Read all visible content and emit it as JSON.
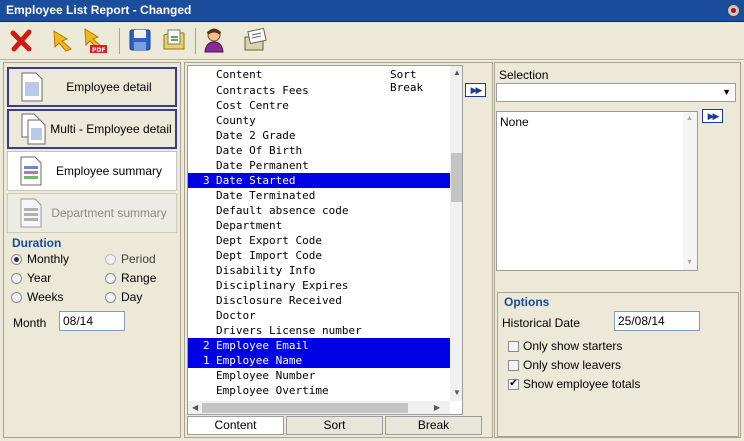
{
  "window": {
    "title": "Employee List Report - Changed"
  },
  "toolbar": {
    "items": [
      "delete-icon",
      "run-report-icon",
      "export-pdf-icon",
      "save-icon",
      "open-icon",
      "user-icon",
      "options-icon"
    ]
  },
  "reports": [
    {
      "label": "Employee detail"
    },
    {
      "label": "Multi - Employee detail"
    },
    {
      "label": "Employee summary"
    },
    {
      "label": "Department summary"
    }
  ],
  "duration": {
    "title": "Duration",
    "options": [
      "Monthly",
      "Period",
      "Year",
      "Range",
      "Weeks",
      "Day"
    ],
    "selected": "Monthly",
    "month_label": "Month",
    "month_value": "08/14"
  },
  "content_list": {
    "header_content": "Content",
    "header_sort": "Sort Break",
    "rows": [
      {
        "num": "",
        "text": "Contracts Fees",
        "selected": false
      },
      {
        "num": "",
        "text": "Cost Centre",
        "selected": false
      },
      {
        "num": "",
        "text": "County",
        "selected": false
      },
      {
        "num": "",
        "text": "Date 2 Grade",
        "selected": false
      },
      {
        "num": "",
        "text": "Date Of Birth",
        "selected": false
      },
      {
        "num": "",
        "text": "Date Permanent",
        "selected": false
      },
      {
        "num": "3",
        "text": "Date Started",
        "selected": true
      },
      {
        "num": "",
        "text": "Date Terminated",
        "selected": false
      },
      {
        "num": "",
        "text": "Default absence code",
        "selected": false
      },
      {
        "num": "",
        "text": "Department",
        "selected": false
      },
      {
        "num": "",
        "text": "Dept Export Code",
        "selected": false
      },
      {
        "num": "",
        "text": "Dept Import Code",
        "selected": false
      },
      {
        "num": "",
        "text": "Disability Info",
        "selected": false
      },
      {
        "num": "",
        "text": "Disciplinary Expires",
        "selected": false
      },
      {
        "num": "",
        "text": "Disclosure Received",
        "selected": false
      },
      {
        "num": "",
        "text": "Doctor",
        "selected": false
      },
      {
        "num": "",
        "text": "Drivers License number",
        "selected": false
      },
      {
        "num": "2",
        "text": "Employee Email",
        "selected": true
      },
      {
        "num": "1",
        "text": "Employee Name",
        "selected": true
      },
      {
        "num": "",
        "text": "Employee Number",
        "selected": false
      },
      {
        "num": "",
        "text": "Employee Overtime",
        "selected": false
      }
    ],
    "tabs": [
      "Content",
      "Sort",
      "Break"
    ],
    "active_tab": "Content"
  },
  "selection": {
    "label": "Selection",
    "combo_value": "",
    "selected_items": [
      "None"
    ]
  },
  "options": {
    "title": "Options",
    "historical_date_label": "Historical Date",
    "historical_date_value": "25/08/14",
    "checkboxes": [
      {
        "label": "Only show starters",
        "checked": false
      },
      {
        "label": "Only show leavers",
        "checked": false
      },
      {
        "label": "Show employee totals",
        "checked": true
      }
    ]
  },
  "colors": {
    "titlebar": "#1a4e9c",
    "selection_highlight": "#0000e6",
    "section_title": "#1b4a9c"
  }
}
